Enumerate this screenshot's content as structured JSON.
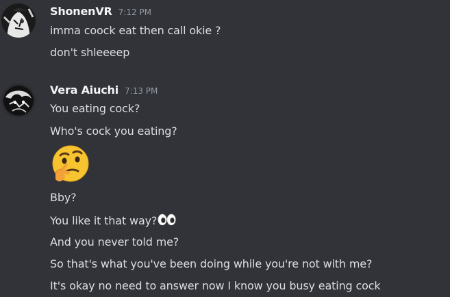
{
  "messages": [
    {
      "author": "ShonenVR",
      "time": "7:12 PM",
      "lines": [
        "imma coock eat then call okie ?",
        "don't shleeeep"
      ]
    },
    {
      "author": "Vera Aiuchi",
      "time": "7:13 PM",
      "lines": [
        "You eating cock?",
        "Who's cock you eating?",
        "Bby?",
        "You like it that way?",
        "And you never told me?",
        "So that's what you've been doing while you're not with me?",
        "It's okay no need to answer now I know you busy eating cock"
      ],
      "big_emoji": "thinking-face-emoji",
      "inline_emoji": "eyes-emoji"
    }
  ],
  "colors": {
    "background": "#313338",
    "username": "#f2f3f5",
    "text": "#dbdee1",
    "timestamp": "#949ba4"
  }
}
